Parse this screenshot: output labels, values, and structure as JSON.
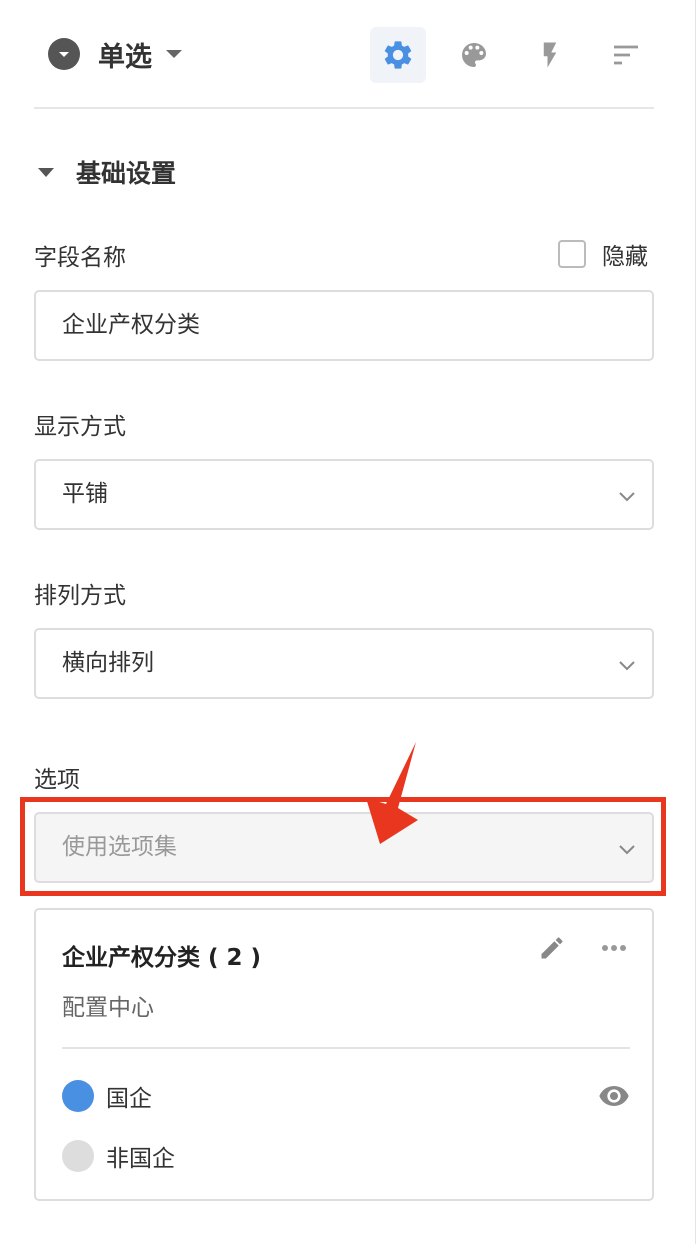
{
  "header": {
    "field_type": "单选",
    "tools": [
      {
        "icon": "gear-icon",
        "active": true
      },
      {
        "icon": "palette-icon",
        "active": false
      },
      {
        "icon": "lightning-icon",
        "active": false
      },
      {
        "icon": "sort-icon",
        "active": false
      }
    ]
  },
  "section": {
    "title": "基础设置"
  },
  "field_name": {
    "label": "字段名称",
    "hide_label": "隐藏",
    "hidden": false,
    "value": "企业产权分类"
  },
  "display_mode": {
    "label": "显示方式",
    "value": "平铺"
  },
  "arrangement": {
    "label": "排列方式",
    "value": "横向排列"
  },
  "options": {
    "label": "选项",
    "source_placeholder": "使用选项集",
    "set": {
      "title": "企业产权分类 ( 2 )",
      "subtitle": "配置中心",
      "items": [
        {
          "label": "国企",
          "color": "#4a90e2"
        },
        {
          "label": "非国企",
          "color": "#dddddd"
        }
      ]
    }
  },
  "colors": {
    "accent": "#4a90e2",
    "highlight": "#e8361f"
  }
}
